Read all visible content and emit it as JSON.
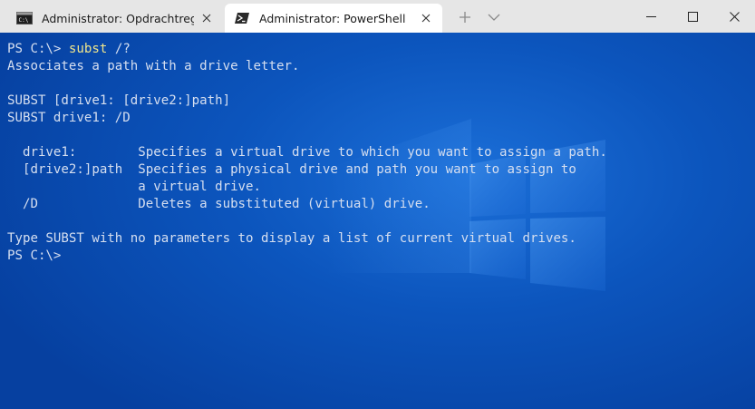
{
  "tabs": [
    {
      "title": "Administrator: Opdrachtregelpr",
      "icon": "cmd-icon",
      "active": false
    },
    {
      "title": "Administrator: PowerShell",
      "icon": "powershell-icon",
      "active": true
    }
  ],
  "titlebar": {
    "new_tab": "+",
    "dropdown": "⌄"
  },
  "terminal": {
    "prompt1": "PS C:\\>",
    "command": "subst",
    "command_arg": "/?",
    "lines": [
      "Associates a path with a drive letter.",
      "",
      "SUBST [drive1: [drive2:]path]",
      "SUBST drive1: /D",
      "",
      "  drive1:        Specifies a virtual drive to which you want to assign a path.",
      "  [drive2:]path  Specifies a physical drive and path you want to assign to",
      "                 a virtual drive.",
      "  /D             Deletes a substituted (virtual) drive.",
      "",
      "Type SUBST with no parameters to display a list of current virtual drives."
    ],
    "prompt2": "PS C:\\>"
  },
  "colors": {
    "background": "#0a4fb2",
    "text": "#d6dff0",
    "command": "#f0e68c",
    "tabbar": "#e6e6e6"
  }
}
